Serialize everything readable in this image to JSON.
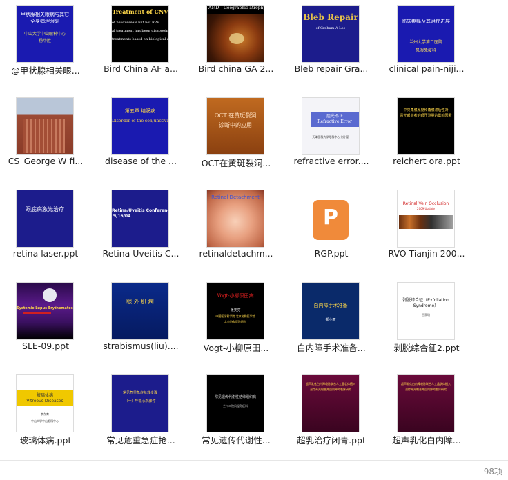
{
  "files": [
    {
      "label": "@甲状腺相关眼...",
      "thumb": {
        "lines": [
          "甲状腺相关眼病与其它",
          "全身病理眼副",
          "中山大学中山眼科中心",
          "杨华胜"
        ]
      }
    },
    {
      "label": "Bird China AF a...",
      "thumb": {
        "lines": [
          "Treatment of CNV",
          "of new vessels but not RPE",
          "al treatment has been disappointing",
          "treatments based on biological approac"
        ]
      }
    },
    {
      "label": "Bird china GA 2...",
      "thumb": {
        "lines": [
          "AMD – Geographic atrophy"
        ]
      }
    },
    {
      "label": "Bleb repair Gra...",
      "thumb": {
        "lines": [
          "Bleb Repair",
          "of Graham A Lee"
        ]
      }
    },
    {
      "label": "clinical pain-niji...",
      "thumb": {
        "lines": [
          "临床疼痛及其治疗进展",
          "兰州大学第二医院",
          "风湿免疫科"
        ]
      }
    },
    {
      "label": "CS_George W fi...",
      "thumb": {
        "lines": []
      }
    },
    {
      "label": "disease of the ...",
      "thumb": {
        "lines": [
          "第五章 结膜病",
          "Disorder of the conjunctiva"
        ]
      }
    },
    {
      "label": "OCT在黄斑裂洞...",
      "thumb": {
        "lines": [
          "OCT 在黄斑裂洞",
          "诊断中的应用"
        ]
      }
    },
    {
      "label": "refractive error....",
      "thumb": {
        "lines": [
          "屈光不正",
          "Refractive Error",
          "天津医科大学眼科中心 刘小丽"
        ]
      }
    },
    {
      "label": "reichert ora.ppt",
      "thumb": {
        "lines": [
          "中央角膜厚度和角膜滞后性对",
          "青光眼患者的眼压测量的影响因素"
        ]
      }
    },
    {
      "label": "retina laser.ppt",
      "thumb": {
        "lines": [
          "眼底病激光治疗"
        ]
      }
    },
    {
      "label": "Retina Uveitis C...",
      "thumb": {
        "lines": [
          "Retina/Uveitis Conference",
          "9/16/04"
        ]
      }
    },
    {
      "label": "retinaldetachm...",
      "thumb": {
        "lines": [
          "Retinal Detachment"
        ]
      }
    },
    {
      "label": "RGP.ppt",
      "thumb": {
        "lines": [
          "P"
        ]
      }
    },
    {
      "label": "RVO Tianjin 200...",
      "thumb": {
        "lines": [
          "Retinal Vein Occlusion",
          "2009 Update"
        ]
      }
    },
    {
      "label": "SLE-09.ppt",
      "thumb": {
        "lines": [
          "Systemic Lupus Erythematosus"
        ]
      }
    },
    {
      "label": "strabismus(liu)....",
      "thumb": {
        "lines": [
          "眼 外 肌 病"
        ]
      }
    },
    {
      "label": "Vogt-小柳原田...",
      "thumb": {
        "lines": [
          "Vogt-小柳原田病",
          "张美芬",
          "中国医学科学院 北京协和医学院",
          "北京协和医院眼科"
        ]
      }
    },
    {
      "label": "白内障手术准备...",
      "thumb": {
        "lines": [
          "白内障手术准备",
          "郑小丽"
        ]
      }
    },
    {
      "label": "剥脱综合征2.ppt",
      "thumb": {
        "lines": [
          "剥脱综合征（Exfoliation",
          "Syndrome）",
          "王家瑞"
        ]
      }
    },
    {
      "label": "玻璃体病.ppt",
      "thumb": {
        "lines": [
          "玻璃体病",
          "Vitreous Diseases",
          "李东育",
          "中山大学中山眼科中心"
        ]
      }
    },
    {
      "label": "常见危重急症抢...",
      "thumb": {
        "lines": [
          "常见危重急症抢救步骤",
          "（一）呼吸心跳骤停"
        ]
      }
    },
    {
      "label": "常见遗传代谢性...",
      "thumb": {
        "lines": [
          "常见遗传代谢性结缔组织病",
          "兰州二院风湿免疫科"
        ]
      }
    },
    {
      "label": "超乳治疗闭青.ppt",
      "thumb": {
        "lines": [
          "超声乳化白内障吸除联合人工晶状体植入",
          "治疗青光眼合并白内障的临床研究"
        ]
      }
    },
    {
      "label": "超声乳化白内障...",
      "thumb": {
        "lines": [
          "超声乳化白内障吸除联合人工晶状体植入",
          "治疗青光眼合并白内障的临床研究"
        ]
      }
    }
  ],
  "status": {
    "item_count": "98项"
  },
  "colors": {
    "accent_orange": "#f08a3a",
    "slide_blue": "#1a1ab0",
    "slide_navy": "#1c1c8c"
  }
}
